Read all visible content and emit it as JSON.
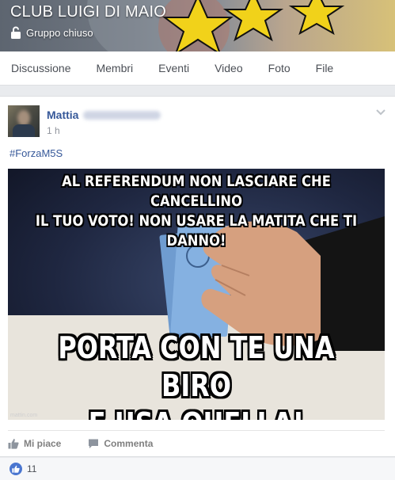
{
  "group": {
    "name": "CLUB LUIGI DI MAIO",
    "privacy": "Gruppo chiuso"
  },
  "tabs": [
    {
      "label": "Discussione"
    },
    {
      "label": "Membri"
    },
    {
      "label": "Eventi"
    },
    {
      "label": "Video"
    },
    {
      "label": "Foto"
    },
    {
      "label": "File"
    }
  ],
  "post": {
    "author": "Mattia",
    "time": "1 h",
    "hashtag": "#ForzaM5S",
    "image": {
      "top_text": [
        "AL REFERENDUM NON LASCIARE CHE CANCELLINO",
        "IL TUO VOTO! NON USARE LA MATITA CHE TI DANNO!"
      ],
      "bottom_text": [
        "PORTA CON TE UNA BIRO",
        "E USA QUELLA! #IOVOTO"
      ],
      "watermark": "mattin.com"
    },
    "actions": {
      "like": "Mi piace",
      "comment": "Commenta"
    },
    "reactions": {
      "count": "11"
    }
  },
  "colors": {
    "link": "#365899",
    "like_blue": "#4a76d0",
    "page_bg": "#e9ebee"
  }
}
